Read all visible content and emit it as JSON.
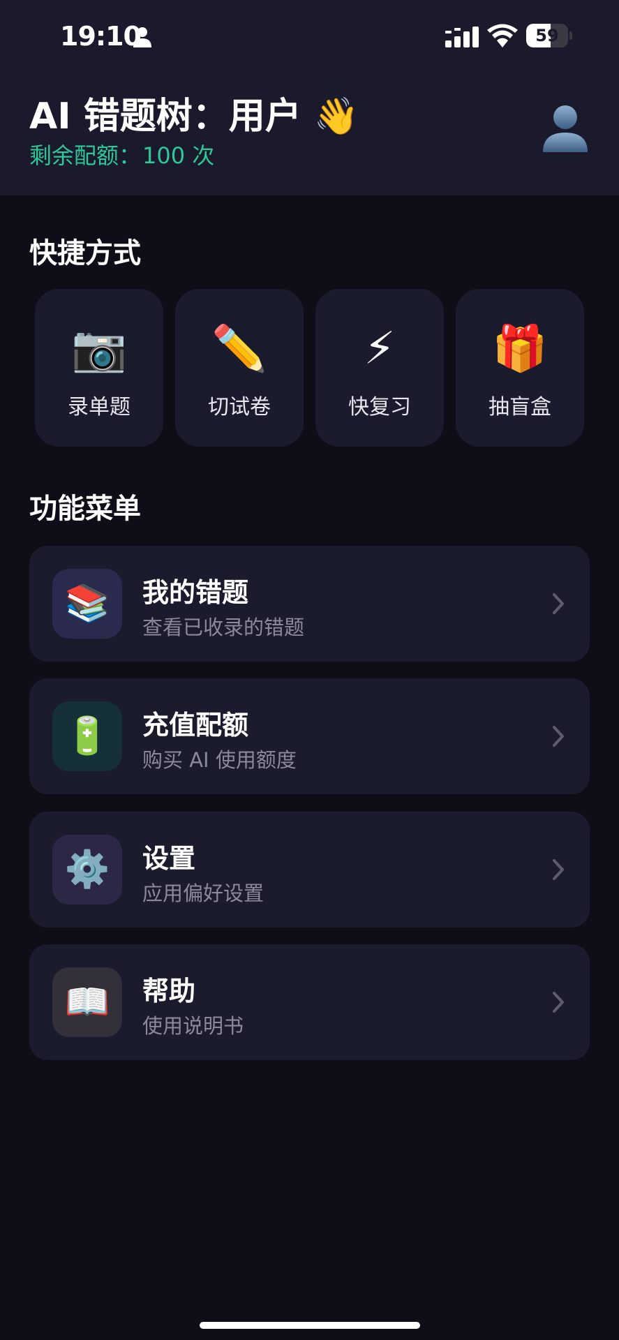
{
  "status_bar": {
    "time": "19:10",
    "battery_level": "59",
    "battery_fraction": 0.59
  },
  "header": {
    "title": "AI 错题树：用户 👋",
    "quota_label": "剩余配额：",
    "quota_value": "100 次",
    "avatar_icon": "👤"
  },
  "shortcuts": {
    "section_title": "快捷方式",
    "items": [
      {
        "icon": "📷",
        "icon_name": "camera-icon",
        "label": "录单题"
      },
      {
        "icon": "✏️",
        "icon_name": "pencil-icon",
        "label": "切试卷"
      },
      {
        "icon": "⚡",
        "icon_name": "lightning-icon",
        "label": "快复习"
      },
      {
        "icon": "🎁",
        "icon_name": "gift-icon",
        "label": "抽盲盒"
      }
    ]
  },
  "menu": {
    "section_title": "功能菜单",
    "items": [
      {
        "icon": "📚",
        "icon_name": "books-icon",
        "icon_bg": "#2a2a4e",
        "title": "我的错题",
        "subtitle": "查看已收录的错题"
      },
      {
        "icon": "🔋",
        "icon_name": "battery-icon",
        "icon_bg": "#16303a",
        "title": "充值配额",
        "subtitle": "购买 AI 使用额度"
      },
      {
        "icon": "⚙️",
        "icon_name": "gear-icon",
        "icon_bg": "#2b2745",
        "title": "设置",
        "subtitle": "应用偏好设置"
      },
      {
        "icon": "📖",
        "icon_name": "open-book-icon",
        "icon_bg": "#33303a",
        "title": "帮助",
        "subtitle": "使用说明书"
      }
    ]
  },
  "colors": {
    "background": "#0e0e18",
    "header_bg": "#1a1a2c",
    "card_bg": "#1b1b2e",
    "accent_green": "#2ec79a",
    "subtitle_gray": "#8a8a98"
  }
}
